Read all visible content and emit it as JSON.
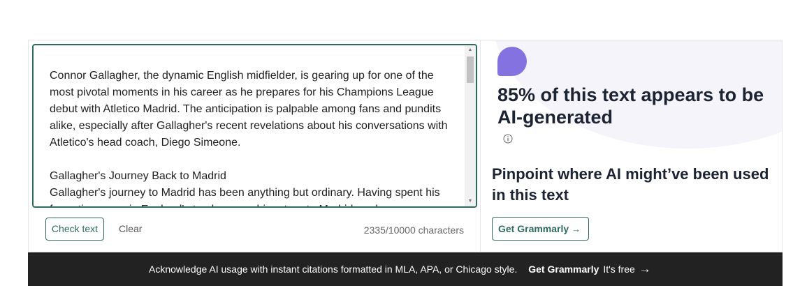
{
  "editor": {
    "text": "Connor Gallagher, the dynamic English midfielder, is gearing up for one of the most pivotal moments in his career as he prepares for his Champions League debut with Atletico Madrid. The anticipation is palpable among fans and pundits alike, especially after Gallagher's recent revelations about his conversations with Atletico's head coach, Diego Simeone.\n\nGallagher's Journey Back to Madrid\nGallagher's journey to Madrid has been anything but ordinary. Having spent his formative years in England's top leagues, his return to Madrid marks a",
    "check_label": "Check text",
    "clear_label": "Clear",
    "char_count": "2335/10000 characters"
  },
  "result": {
    "title": "85% of this text appears to be AI-generated",
    "percent": 85,
    "pinpoint": "Pinpoint where AI might’ve been used in this text",
    "cta_label": "Get Grammarly",
    "cta_arrow": "→"
  },
  "banner": {
    "text": "Acknowledge AI usage with instant citations formatted in MLA, APA, or Chicago style.",
    "cta": "Get Grammarly",
    "free": "It's free",
    "arrow": "→"
  },
  "colors": {
    "accent": "#2e6b5e",
    "ai_icon": "#8472e0",
    "banner_bg": "#222222",
    "blob": "#f4f4fa"
  }
}
